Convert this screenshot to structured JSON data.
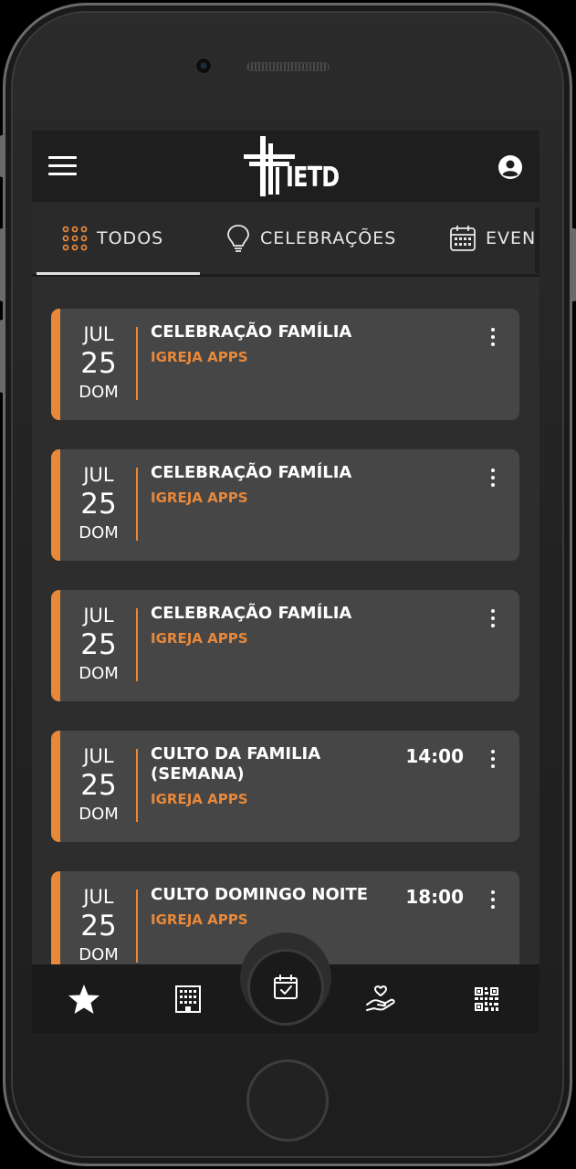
{
  "app": {
    "logo_text": "IETD"
  },
  "tabs": [
    {
      "label": "TODOS",
      "icon": "grid-dots-icon",
      "active": true
    },
    {
      "label": "CELEBRAÇÕES",
      "icon": "lightbulb-icon",
      "active": false
    },
    {
      "label": "EVEN",
      "icon": "calendar-icon",
      "active": false
    }
  ],
  "events": [
    {
      "month": "JUL",
      "day": "25",
      "weekday": "DOM",
      "title": "CELEBRAÇÃO FAMÍLIA",
      "subtitle": "IGREJA APPS",
      "time": ""
    },
    {
      "month": "JUL",
      "day": "25",
      "weekday": "DOM",
      "title": "CELEBRAÇÃO FAMÍLIA",
      "subtitle": "IGREJA APPS",
      "time": ""
    },
    {
      "month": "JUL",
      "day": "25",
      "weekday": "DOM",
      "title": "CELEBRAÇÃO FAMÍLIA",
      "subtitle": "IGREJA APPS",
      "time": ""
    },
    {
      "month": "JUL",
      "day": "25",
      "weekday": "DOM",
      "title": "CULTO DA FAMILIA (SEMANA)",
      "subtitle": "IGREJA APPS",
      "time": "14:00"
    },
    {
      "month": "JUL",
      "day": "25",
      "weekday": "DOM",
      "title": "CULTO DOMINGO NOITE",
      "subtitle": "IGREJA APPS",
      "time": "18:00"
    }
  ],
  "bottom_nav": [
    {
      "icon": "star-icon"
    },
    {
      "icon": "building-icon"
    },
    {
      "icon": "calendar-check-icon",
      "center": true
    },
    {
      "icon": "hand-heart-icon"
    },
    {
      "icon": "qr-code-icon"
    }
  ],
  "colors": {
    "accent": "#e8883a",
    "card": "#464646",
    "background": "#2d2d2d",
    "bar": "#1e1e1e"
  }
}
